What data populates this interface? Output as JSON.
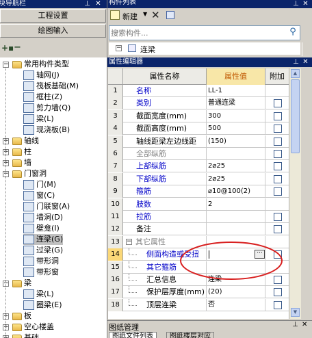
{
  "left_panel": {
    "title": "模块导航栏",
    "btn_project": "工程设置",
    "btn_draw": "绘图输入",
    "tree": [
      {
        "label": "常用构件类型",
        "exp": "-",
        "lvl": 0,
        "folder": true
      },
      {
        "label": "轴网(J)",
        "lvl": 1
      },
      {
        "label": "筏板基础(M)",
        "lvl": 1
      },
      {
        "label": "框柱(Z)",
        "lvl": 1
      },
      {
        "label": "剪力墙(Q)",
        "lvl": 1
      },
      {
        "label": "梁(L)",
        "lvl": 1
      },
      {
        "label": "现浇板(B)",
        "lvl": 1
      },
      {
        "label": "轴线",
        "exp": "+",
        "lvl": 0,
        "folder": true
      },
      {
        "label": "柱",
        "exp": "+",
        "lvl": 0,
        "folder": true
      },
      {
        "label": "墙",
        "exp": "+",
        "lvl": 0,
        "folder": true
      },
      {
        "label": "门窗洞",
        "exp": "-",
        "lvl": 0,
        "folder": true
      },
      {
        "label": "门(M)",
        "lvl": 1
      },
      {
        "label": "窗(C)",
        "lvl": 1
      },
      {
        "label": "门联窗(A)",
        "lvl": 1
      },
      {
        "label": "墙洞(D)",
        "lvl": 1
      },
      {
        "label": "壁龛(I)",
        "lvl": 1
      },
      {
        "label": "连梁(G)",
        "lvl": 1,
        "selected": true
      },
      {
        "label": "过梁(G)",
        "lvl": 1
      },
      {
        "label": "带形洞",
        "lvl": 1
      },
      {
        "label": "带形窗",
        "lvl": 1
      },
      {
        "label": "梁",
        "exp": "-",
        "lvl": 0,
        "folder": true
      },
      {
        "label": "梁(L)",
        "lvl": 1
      },
      {
        "label": "圈梁(E)",
        "lvl": 1
      },
      {
        "label": "板",
        "exp": "+",
        "lvl": 0,
        "folder": true
      },
      {
        "label": "空心楼盖",
        "exp": "+",
        "lvl": 0,
        "folder": true
      },
      {
        "label": "基础",
        "exp": "+",
        "lvl": 0,
        "folder": true
      }
    ]
  },
  "component_list": {
    "title": "构件列表",
    "new_label": "新建",
    "search_placeholder": "搜索构件...",
    "first_item": "连梁"
  },
  "property_editor": {
    "title": "属性编辑器",
    "col_name": "属性名称",
    "col_value": "属性值",
    "col_add": "附加",
    "rows": [
      {
        "num": "1",
        "name": "名称",
        "value": "LL-1",
        "style": "blue",
        "chk": false
      },
      {
        "num": "2",
        "name": "类别",
        "value": "普通连梁",
        "style": "blue",
        "chk": true
      },
      {
        "num": "3",
        "name": "截面宽度(mm)",
        "value": "300",
        "style": "",
        "chk": true
      },
      {
        "num": "4",
        "name": "截面高度(mm)",
        "value": "500",
        "style": "",
        "chk": true
      },
      {
        "num": "5",
        "name": "轴线距梁左边线距",
        "value": "(150)",
        "style": "",
        "chk": true
      },
      {
        "num": "6",
        "name": "全部纵筋",
        "value": "",
        "style": "gray",
        "chk": true
      },
      {
        "num": "7",
        "name": "上部纵筋",
        "value": "2⌀25",
        "style": "blue",
        "chk": true
      },
      {
        "num": "8",
        "name": "下部纵筋",
        "value": "2⌀25",
        "style": "blue",
        "chk": true
      },
      {
        "num": "9",
        "name": "箍筋",
        "value": "⌀10@100(2)",
        "style": "blue",
        "chk": true
      },
      {
        "num": "10",
        "name": "肢数",
        "value": "2",
        "style": "blue",
        "chk": false
      },
      {
        "num": "11",
        "name": "拉筋",
        "value": "",
        "style": "blue",
        "chk": true
      },
      {
        "num": "12",
        "name": "备注",
        "value": "",
        "style": "",
        "chk": true
      },
      {
        "num": "13",
        "name": "其它属性",
        "value": "",
        "style": "gray",
        "group": true,
        "chk": false
      },
      {
        "num": "14",
        "name": "侧面构造或受扭",
        "value": "",
        "style": "blue",
        "editing": true,
        "chk": true
      },
      {
        "num": "15",
        "name": "其它箍筋",
        "value": "",
        "style": "blue",
        "chk": false
      },
      {
        "num": "16",
        "name": "汇总信息",
        "value": "连梁",
        "style": "",
        "chk": true
      },
      {
        "num": "17",
        "name": "保护层厚度(mm)",
        "value": "(20)",
        "style": "",
        "chk": true
      },
      {
        "num": "18",
        "name": "顶层连梁",
        "value": "否",
        "style": "",
        "chk": true
      }
    ]
  },
  "drawing_mgmt": {
    "title": "图纸管理",
    "tab1": "图纸文件列表",
    "tab2": "图纸楼层对应"
  },
  "colors": {
    "titlebar": "#0a246a",
    "highlight_ring": "#d82020",
    "link_blue": "#0000c8"
  }
}
